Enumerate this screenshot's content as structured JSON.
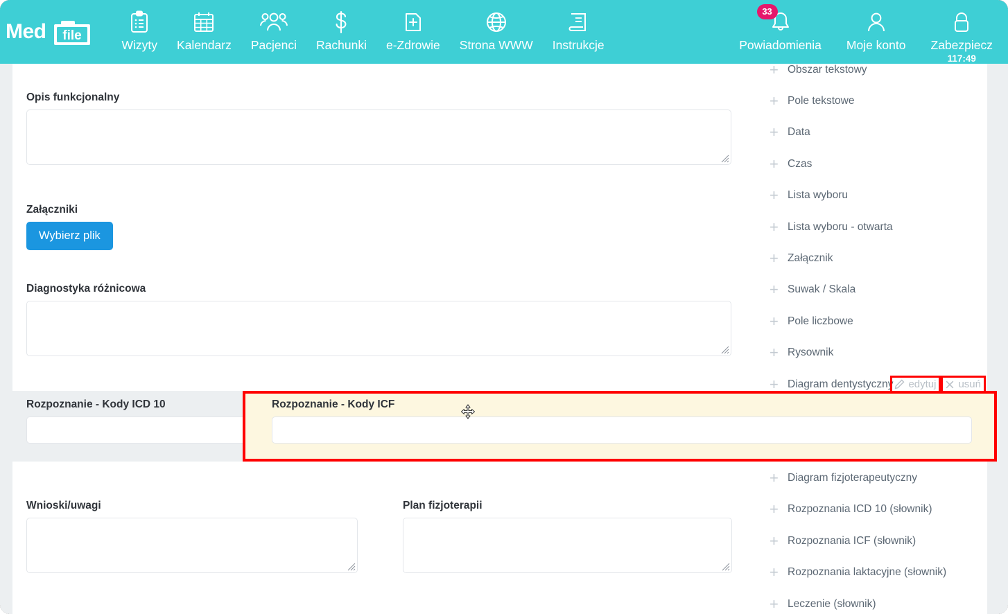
{
  "brand": {
    "name_part1": "Med",
    "name_part2": "file"
  },
  "topnav": {
    "items": [
      {
        "label": "Wizyty",
        "icon": "clipboard-icon"
      },
      {
        "label": "Kalendarz",
        "icon": "calendar-icon"
      },
      {
        "label": "Pacjenci",
        "icon": "users-icon"
      },
      {
        "label": "Rachunki",
        "icon": "dollar-icon"
      },
      {
        "label": "e-Zdrowie",
        "icon": "medical-card-icon"
      },
      {
        "label": "Strona WWW",
        "icon": "globe-icon"
      },
      {
        "label": "Instrukcje",
        "icon": "book-icon"
      }
    ],
    "right": {
      "notifications": {
        "label": "Powiadomienia",
        "badge": "33",
        "icon": "bell-icon"
      },
      "account": {
        "label": "Moje konto",
        "icon": "user-icon"
      },
      "secure": {
        "label": "Zabezpiecz",
        "timer": "117:49",
        "icon": "lock-icon"
      }
    }
  },
  "form": {
    "opis_funkcjonalny": {
      "label": "Opis funkcjonalny",
      "value": ""
    },
    "zalaczniki": {
      "label": "Załączniki",
      "button": "Wybierz plik"
    },
    "diagnostyka": {
      "label": "Diagnostyka różnicowa",
      "value": ""
    },
    "icd10": {
      "label": "Rozpoznanie - Kody ICD 10",
      "value": ""
    },
    "icf": {
      "label": "Rozpoznanie - Kody ICF",
      "value": ""
    },
    "wnioski": {
      "label": "Wnioski/uwagi",
      "value": ""
    },
    "plan": {
      "label": "Plan fizjoterapii",
      "value": ""
    }
  },
  "sidebar": {
    "items": [
      {
        "label": "Obszar tekstowy"
      },
      {
        "label": "Pole tekstowe"
      },
      {
        "label": "Data"
      },
      {
        "label": "Czas"
      },
      {
        "label": "Lista wyboru"
      },
      {
        "label": "Lista wyboru - otwarta"
      },
      {
        "label": "Załącznik"
      },
      {
        "label": "Suwak / Skala"
      },
      {
        "label": "Pole liczbowe"
      },
      {
        "label": "Rysownik"
      },
      {
        "label": "Diagram dentystyczny"
      },
      {
        "label": "Diagram fizjoterapeutyczny"
      },
      {
        "label": "Rozpoznania ICD 10 (słownik)"
      },
      {
        "label": "Rozpoznania ICF (słownik)"
      },
      {
        "label": "Rozpoznania laktacyjne (słownik)"
      },
      {
        "label": "Leczenie (słownik)"
      }
    ],
    "actions": {
      "edit": {
        "label": "edytuj",
        "icon": "pencil-icon"
      },
      "delete": {
        "label": "usuń",
        "icon": "close-icon"
      }
    }
  },
  "colors": {
    "brand_teal": "#3ecfd5",
    "badge_pink": "#e5176b",
    "primary_blue": "#1b96e0",
    "highlight_yellow": "#fdf7e0",
    "highlight_border": "#ff0000",
    "drop_gray": "#eceff1"
  },
  "cursor": {
    "type": "move-cursor"
  }
}
